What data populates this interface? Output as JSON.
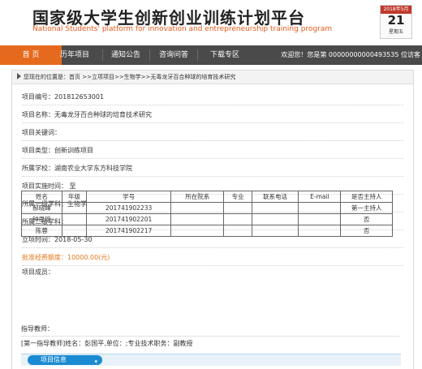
{
  "header": {
    "title": "国家级大学生创新创业训练计划平台",
    "subtitle": "National Students' platform for innovation and entrepreneurship training program",
    "calendar": {
      "month": "2018年5月",
      "day": "21",
      "weekday": "星期五"
    }
  },
  "nav": {
    "items": [
      "首  页",
      "历年项目",
      "通知公告",
      "咨询问答",
      "下载专区"
    ],
    "welcome": "欢迎您！您是第 00000000000493535 位访客"
  },
  "breadcrumb": "您现在的位置是：首页 >>立项项目>>生物学>>无毒龙牙百合种球的培育技术研究",
  "fields": [
    {
      "label": "项目编号：",
      "value": "201812653001"
    },
    {
      "label": "项目名称：",
      "value": "无毒龙牙百合种球的培育技术研究"
    },
    {
      "label": "项目关键词：",
      "value": ""
    },
    {
      "label": "项目类型：",
      "value": "创新训练项目"
    },
    {
      "label": "所属学校：",
      "value": "湖南农业大学东方科技学院"
    },
    {
      "label": "项目实施时间：",
      "value": " 至"
    },
    {
      "label": "所属一级学科：",
      "value": "生物学"
    },
    {
      "label": "所属二级学科：",
      "value": ""
    },
    {
      "label": "立项时间：",
      "value": "2018-05-30"
    },
    {
      "label": "批准经费额度：",
      "value": "10000.00(元)"
    },
    {
      "label": "项目成员：",
      "value": ""
    }
  ],
  "members": {
    "headers": [
      "姓名",
      "年级",
      "学号",
      "所在院系",
      "专业",
      "联系电话",
      "E-mail",
      "是否主持人"
    ],
    "rows": [
      [
        "郝晓峰",
        "",
        "201741902233",
        "",
        "",
        "",
        "",
        "第一主持人"
      ],
      [
        "钟思瑶",
        "",
        "201741902201",
        "",
        "",
        "",
        "",
        "否"
      ],
      [
        "陈蓉",
        "",
        "201741902217",
        "",
        "",
        "",
        "",
        "否"
      ]
    ]
  },
  "advisor": {
    "label": "指导教师：",
    "line": "[第一指导教师]姓名：彭国平,单位：;专业技术职务：副教授"
  },
  "section_tab": {
    "label": "项目信息",
    "chevron": "▾"
  }
}
